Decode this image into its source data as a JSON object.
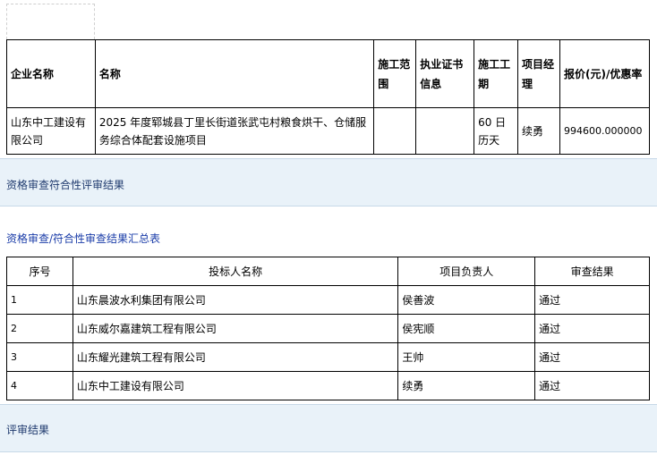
{
  "award_table": {
    "headers": [
      "企业名称",
      "名称",
      "施工范围",
      "执业证书信息",
      "施工工期",
      "项目经理",
      "报价(元)/优惠率"
    ],
    "row": {
      "company": "山东中工建设有限公司",
      "project": "2025 年度郓城县丁里长街道张武屯村粮食烘干、仓储服务综合体配套设施项目",
      "scope": "",
      "certificate": "",
      "duration": "60 日历天",
      "manager": "续勇",
      "price": "994600.000000"
    }
  },
  "section_qualification": {
    "title": "资格审查符合性评审结果"
  },
  "qualification_summary": {
    "title": "资格审查/符合性审查结果汇总表",
    "headers": [
      "序号",
      "投标人名称",
      "项目负责人",
      "审查结果"
    ],
    "rows": [
      {
        "no": "1",
        "bidder": "山东晨波水利集团有限公司",
        "leader": "侯善波",
        "result": "通过"
      },
      {
        "no": "2",
        "bidder": "山东威尔嘉建筑工程有限公司",
        "leader": "侯宪顺",
        "result": "通过"
      },
      {
        "no": "3",
        "bidder": "山东耀光建筑工程有限公司",
        "leader": "王帅",
        "result": "通过"
      },
      {
        "no": "4",
        "bidder": "山东中工建设有限公司",
        "leader": "续勇",
        "result": "通过"
      }
    ]
  },
  "section_review": {
    "title": "评审结果"
  }
}
